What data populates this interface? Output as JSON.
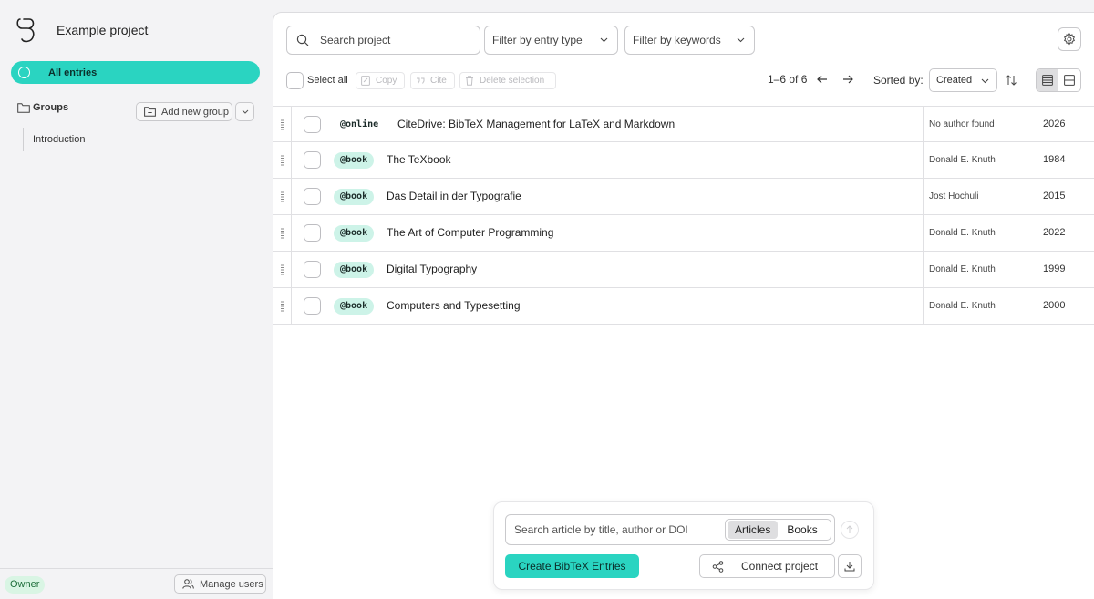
{
  "sidebar": {
    "project_name": "Example project",
    "all_entries_label": "All entries",
    "groups_label": "Groups",
    "add_group_label": "Add new group",
    "groups": [
      {
        "label": "Introduction"
      }
    ],
    "role_badge": "Owner",
    "manage_users_label": "Manage users"
  },
  "header": {
    "search_placeholder": "Search project",
    "filter_entry_type": "Filter by entry type",
    "filter_keywords": "Filter by keywords"
  },
  "toolbar": {
    "select_all": "Select all",
    "copy": "Copy",
    "cite": "Cite",
    "delete_selection": "Delete selection",
    "pager": "1–6 of 6",
    "sorted_by_label": "Sorted by:",
    "sort_value": "Created"
  },
  "entries": [
    {
      "type": "@online",
      "title": "CiteDrive: BibTeX Management for LaTeX and Markdown",
      "author": "No author found",
      "year": "2026"
    },
    {
      "type": "@book",
      "title": "The TeXbook",
      "author": "Donald E. Knuth",
      "year": "1984"
    },
    {
      "type": "@book",
      "title": "Das Detail in der Typografie",
      "author": "Jost Hochuli",
      "year": "2015"
    },
    {
      "type": "@book",
      "title": "The Art of Computer Programming",
      "author": "Donald E. Knuth",
      "year": "2022"
    },
    {
      "type": "@book",
      "title": "Digital Typography",
      "author": "Donald E. Knuth",
      "year": "1999"
    },
    {
      "type": "@book",
      "title": "Computers and Typesetting",
      "author": "Donald E. Knuth",
      "year": "2000"
    }
  ],
  "composer": {
    "search_placeholder": "Search article by title, author or DOI",
    "seg_articles": "Articles",
    "seg_books": "Books",
    "create_label": "Create BibTeX Entries",
    "connect_label": "Connect project"
  },
  "colors": {
    "accent": "#2ad4c1",
    "book_badge": "#cdf3e8",
    "owner_badge": "#d9f5e4"
  }
}
